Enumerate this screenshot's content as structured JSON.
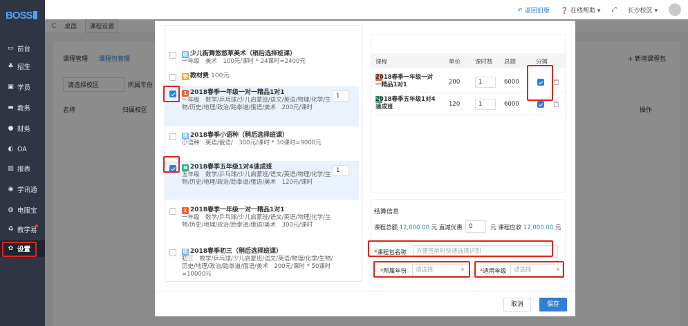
{
  "sidebar": {
    "logo": "BOSS",
    "items": [
      {
        "label": "前台",
        "icon": "monitor-icon",
        "glyph": "▭"
      },
      {
        "label": "招生",
        "icon": "user-add-icon",
        "glyph": "♣"
      },
      {
        "label": "学员",
        "icon": "student-card-icon",
        "glyph": "▣"
      },
      {
        "label": "教务",
        "icon": "screen-icon",
        "glyph": "▬"
      },
      {
        "label": "财务",
        "icon": "finance-icon",
        "glyph": "●"
      },
      {
        "label": "OA",
        "icon": "oa-icon",
        "glyph": "◐"
      },
      {
        "label": "报表",
        "icon": "bar-chart-icon",
        "glyph": "▥"
      },
      {
        "label": "学讯通",
        "icon": "pin-icon",
        "glyph": "◉"
      },
      {
        "label": "电服宝",
        "icon": "phone-icon",
        "glyph": "◍"
      },
      {
        "label": "教学易",
        "icon": "book-icon",
        "glyph": "♻"
      },
      {
        "label": "设置",
        "icon": "gear-icon",
        "glyph": "✿"
      }
    ]
  },
  "topbar": {
    "back_old": "返回旧版",
    "help": "在线帮助",
    "campus": "长沙校区"
  },
  "tabs": {
    "desktop": "桌面",
    "settings": "课程设置"
  },
  "bg": {
    "tab1": "课程管理",
    "tab2": "课程包管理",
    "add_btn": "新增课程包",
    "filter_campus": "请选择校区",
    "filter_year": "所属年份",
    "col_name": "名称",
    "col_campus": "归属校区",
    "col_op": "操作"
  },
  "courses": [
    {
      "tag": "班",
      "tag_color": "blue",
      "title": "少儿街舞悠悠草美术（稍后选择班课）",
      "detail": "一年级　美术　100元/课时 * 24课时=2400元",
      "checked": false
    },
    {
      "tag": "物",
      "tag_color": "orange",
      "title": "教材费",
      "detail": "100元",
      "checked": false
    },
    {
      "tag": "1",
      "tag_color": "red",
      "title": "2018春季一年级一对一精品1对1",
      "detail": "一年级　数学/乒乓球/少儿启蒙班/语文/英语/物理/化学/生物/历史/地理/政治/跆拳道/俄语/美术　200元/课时",
      "checked": true,
      "qty": "1"
    },
    {
      "tag": "班",
      "tag_color": "blue",
      "title": "2018春季小语种（稍后选择班课）",
      "detail": "小语种　英语/俄语/　300元/课时 * 30课时=9000元",
      "checked": false
    },
    {
      "tag": "N",
      "tag_color": "green",
      "title": "2018春季五年级1对4速成班",
      "detail": "五年级　数学/乒乓球/少儿启蒙班/语文/英语/物理/化学/生物/历史/地理/政治/跆拳道/俄语/美术　120元/课时",
      "checked": true,
      "qty": "1"
    },
    {
      "tag": "1",
      "tag_color": "red",
      "title": "2018春季一年级一对一精品1对1",
      "detail": "一年级　数学/乒乓球/少儿启蒙班/语文/英语/物理/化学/生物/历史/地理/政治/跆拳道/俄语/美术　300元/课时",
      "checked": false
    },
    {
      "tag": "班",
      "tag_color": "blue",
      "title": "2018春季初三（稍后选择班课）",
      "detail": "初三　数学/乒乓球/少儿启蒙班/语文/英语/物理/化学/生物/历史/地理/政治/跆拳道/俄语/美术　200元/课时 * 50课时=10000元",
      "checked": false
    }
  ],
  "selected_table": {
    "headers": {
      "course": "课程",
      "price": "单价",
      "hours": "课时数",
      "total": "总额",
      "split": "分摊"
    },
    "rows": [
      {
        "tag": "1",
        "tag_color": "red",
        "name_line1": "2018春季一年级一对",
        "name_line2": "一精品1对1",
        "price": "200",
        "hours": "1",
        "total": "6000",
        "split": true
      },
      {
        "tag": "N",
        "tag_color": "green",
        "name_line1": "2018春季五年级1对4",
        "name_line2": "速成班",
        "price": "120",
        "hours": "1",
        "total": "6000",
        "split": true
      }
    ]
  },
  "settlement": {
    "title": "结算信息",
    "total_label": "课程总额",
    "total_value": "12,000.00",
    "yuan": "元",
    "discount_label": "直减优惠",
    "discount_value": "0",
    "payable_label": "元 课程应收",
    "payable_value": "12,000.00",
    "payable_unit": "元"
  },
  "form": {
    "package_name_label": "课程包名称",
    "package_name_placeholder": "方便签单时快速选择识别",
    "year_label": "所属年份",
    "year_placeholder": "请选择",
    "grade_label": "适用年级",
    "grade_placeholder": "请选择"
  },
  "footer": {
    "cancel": "取消",
    "save": "保存"
  },
  "colors": {
    "accent": "#2f7ed8",
    "annotation": "#e2231a"
  }
}
